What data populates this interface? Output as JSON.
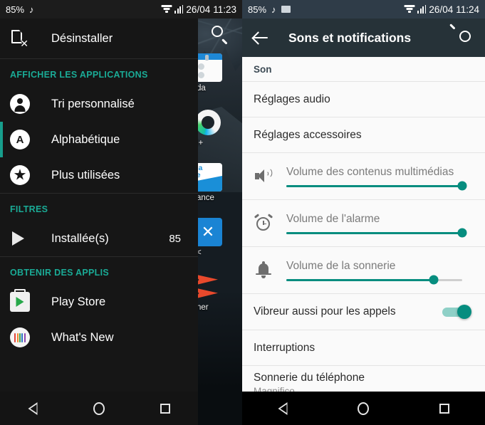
{
  "left_phone": {
    "status_bar": {
      "battery": "85%",
      "music_icon": "music-note-icon",
      "wifi_icon": "wifi-icon",
      "signal_icon": "cellular-signal-icon",
      "date": "26/04",
      "time": "11:23"
    },
    "drawer": {
      "uninstall": {
        "label": "Désinstaller",
        "icon": "uninstall-file-icon"
      },
      "sections": [
        {
          "header": "AFFICHER LES APPLICATIONS",
          "items": [
            {
              "label": "Tri personnalisé",
              "icon": "person-icon",
              "selected": false,
              "count": ""
            },
            {
              "label": "Alphabétique",
              "icon": "alphabetical-icon",
              "selected": true,
              "count": ""
            },
            {
              "label": "Plus utilisées",
              "icon": "star-icon",
              "selected": false,
              "count": ""
            }
          ]
        },
        {
          "header": "FILTRES",
          "items": [
            {
              "label": "Installée(s)",
              "icon": "play-triangle-icon",
              "selected": false,
              "count": "85"
            }
          ]
        },
        {
          "header": "OBTENIR DES APPLIS",
          "items": [
            {
              "label": "Play Store",
              "icon": "play-store-icon",
              "selected": false,
              "count": ""
            },
            {
              "label": "What's New",
              "icon": "whats-new-icon",
              "selected": false,
              "count": ""
            }
          ]
        }
      ]
    },
    "background_search_icon": "search-icon",
    "background_apps": [
      {
        "label": "da",
        "icon": "agenda-icon"
      },
      {
        "label": "l+",
        "icon": "ring-chart-icon"
      },
      {
        "label": "ance",
        "icon": "france-icon"
      },
      {
        "label": "<",
        "icon": "blue-x-icon"
      },
      {
        "label": "ner",
        "icon": "scanner-icon"
      }
    ],
    "navbar": {
      "back": "back-triangle-icon",
      "home": "home-circle-icon",
      "recent": "recents-square-icon"
    }
  },
  "right_phone": {
    "status_bar": {
      "battery": "85%",
      "music_icon": "music-note-icon",
      "image_icon": "image-icon",
      "wifi_icon": "wifi-icon",
      "signal_icon": "cellular-signal-icon",
      "date": "26/04",
      "time": "11:24"
    },
    "toolbar": {
      "back_icon": "back-arrow-icon",
      "title": "Sons et notifications",
      "search_icon": "search-icon"
    },
    "settings": [
      {
        "type": "header",
        "label": "Son"
      },
      {
        "type": "simple",
        "label": "Réglages audio"
      },
      {
        "type": "simple",
        "label": "Réglages accessoires"
      },
      {
        "type": "slider",
        "label": "Volume des contenus multimédias",
        "icon": "speaker-icon",
        "value": 100
      },
      {
        "type": "slider",
        "label": "Volume de l'alarme",
        "icon": "alarm-clock-icon",
        "value": 100
      },
      {
        "type": "slider",
        "label": "Volume de la sonnerie",
        "icon": "bell-icon",
        "value": 84
      },
      {
        "type": "toggle",
        "label": "Vibreur aussi pour les appels",
        "value": true
      },
      {
        "type": "simple",
        "label": "Interruptions"
      },
      {
        "type": "two_line",
        "label": "Sonnerie du téléphone",
        "sublabel": "Magnifico"
      }
    ],
    "navbar": {
      "back": "back-triangle-icon",
      "home": "home-circle-icon",
      "recent": "recents-square-icon"
    }
  },
  "colors": {
    "accent_teal": "#179e8c",
    "slider_teal": "#068d7f",
    "toolbar_dark": "#263238",
    "statusbar_right": "#2f3c48",
    "drawer_bg": "#161616"
  }
}
